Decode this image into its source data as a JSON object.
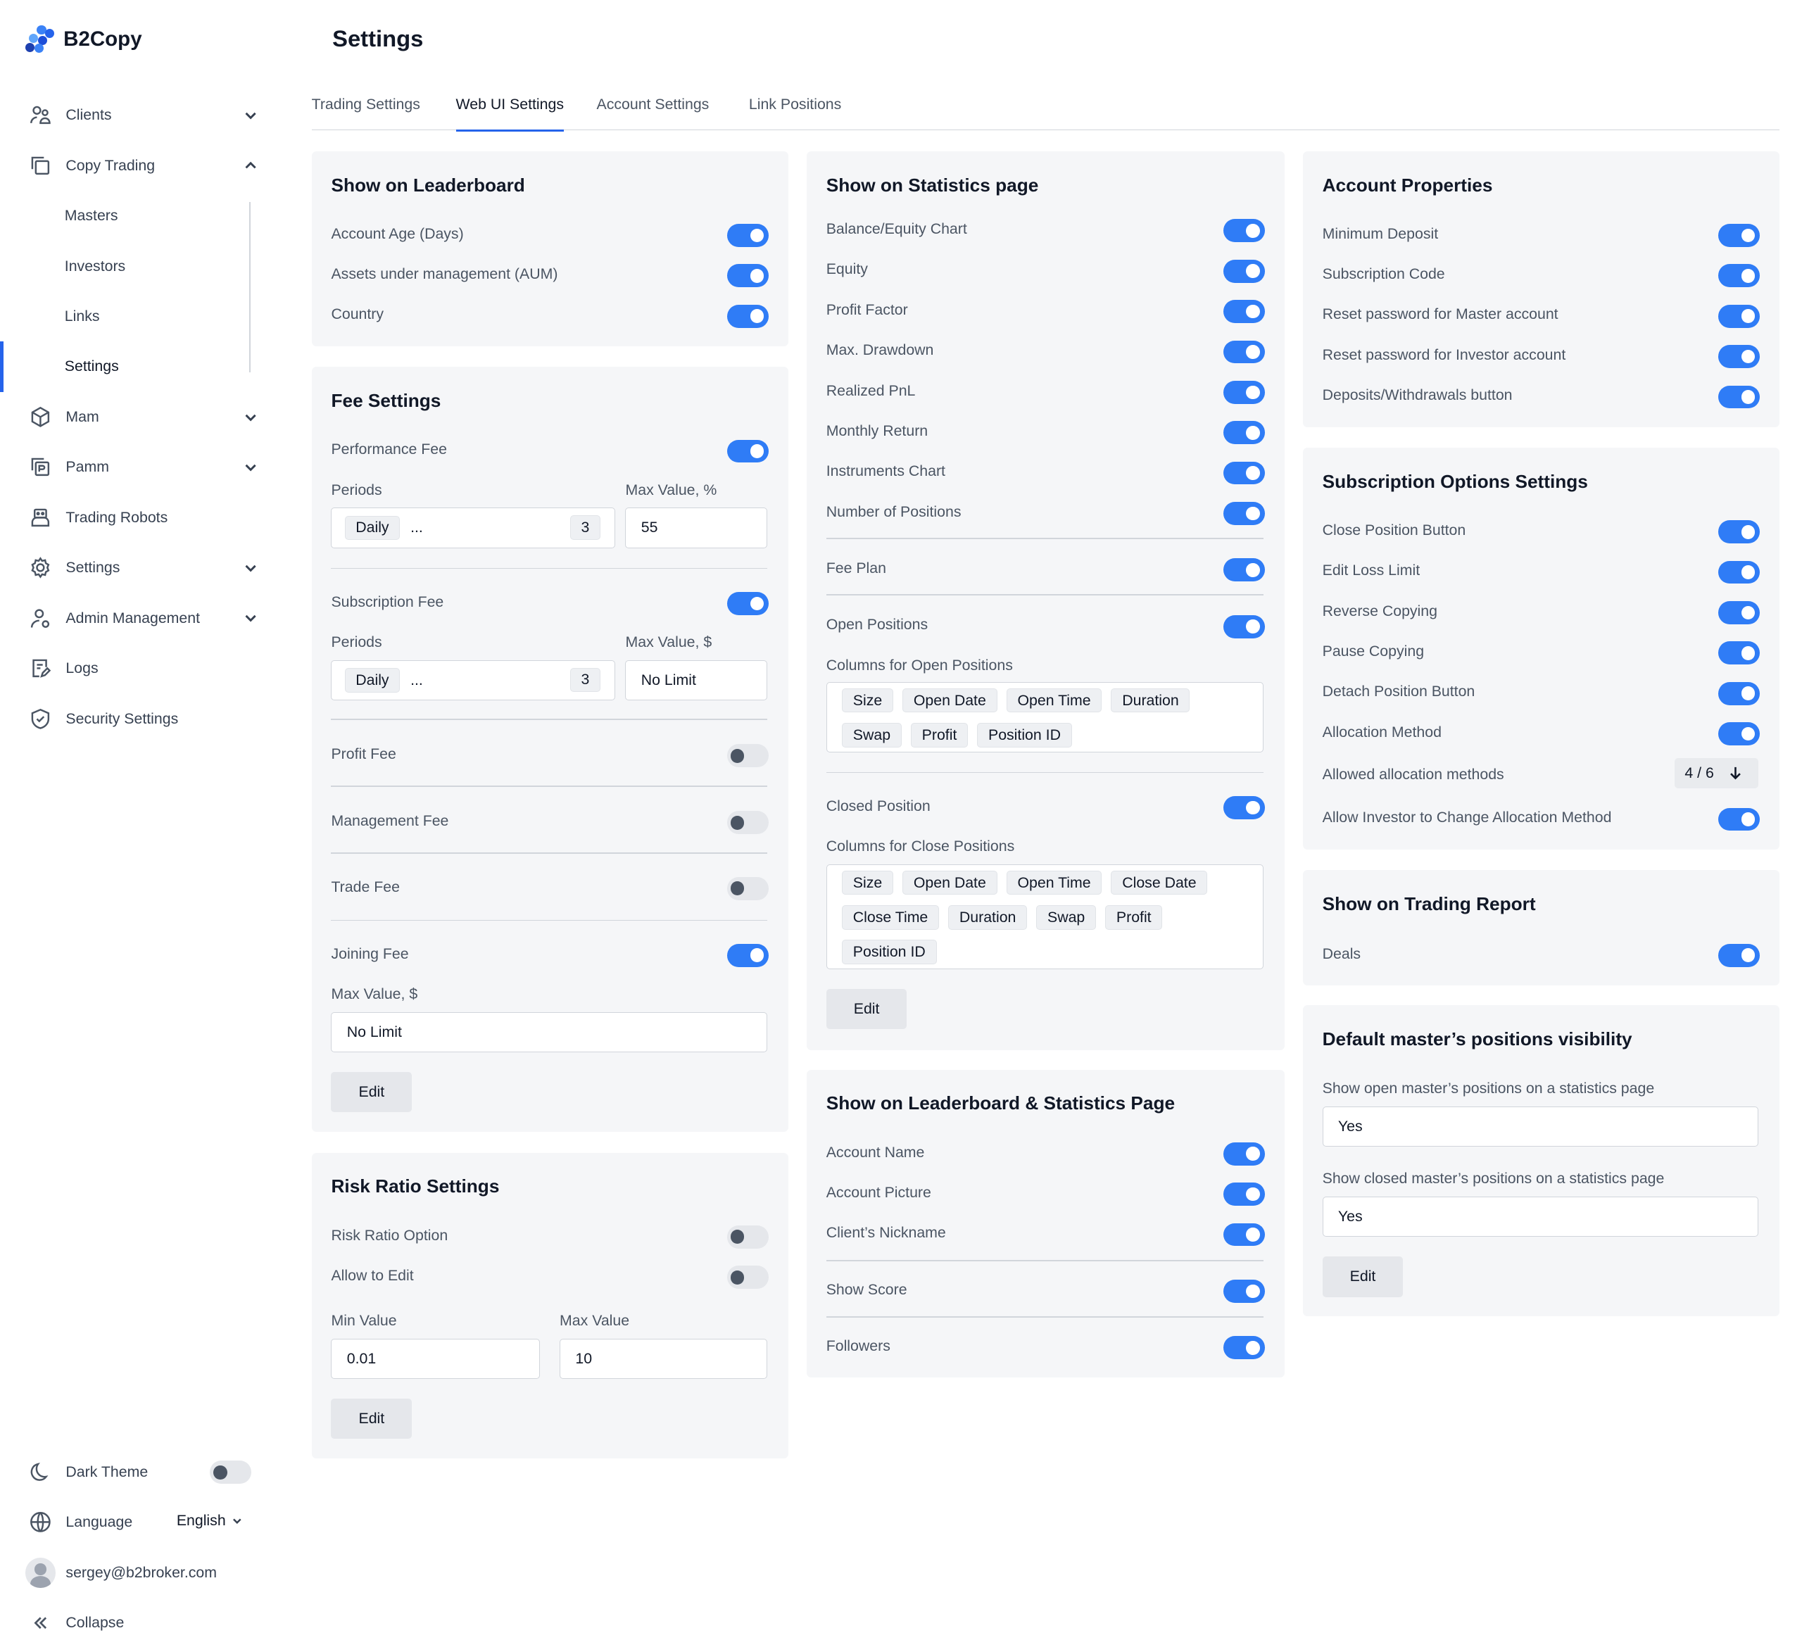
{
  "brand": {
    "name": "B2Copy"
  },
  "sidebar": {
    "items": [
      {
        "label": "Clients",
        "icon": "users-icon",
        "chevron": "down"
      },
      {
        "label": "Copy Trading",
        "icon": "copy-icon",
        "chevron": "up"
      },
      {
        "label": "Masters",
        "sub": true
      },
      {
        "label": "Investors",
        "sub": true
      },
      {
        "label": "Links",
        "sub": true
      },
      {
        "label": "Settings",
        "sub": true,
        "active": true
      },
      {
        "label": "Mam",
        "icon": "cube-icon",
        "chevron": "down"
      },
      {
        "label": "Pamm",
        "icon": "pamm-icon",
        "chevron": "down"
      },
      {
        "label": "Trading Robots",
        "icon": "robot-icon"
      },
      {
        "label": "Settings",
        "icon": "gear-icon",
        "chevron": "down"
      },
      {
        "label": "Admin Management",
        "icon": "admin-icon",
        "chevron": "down"
      },
      {
        "label": "Logs",
        "icon": "logs-icon"
      },
      {
        "label": "Security Settings",
        "icon": "shield-icon"
      }
    ],
    "dark_theme": "Dark Theme",
    "language_label": "Language",
    "language_value": "English",
    "user_email": "sergey@b2broker.com",
    "collapse": "Collapse"
  },
  "page": {
    "title": "Settings"
  },
  "tabs": [
    {
      "label": "Trading Settings",
      "active": false
    },
    {
      "label": "Web UI Settings",
      "active": true
    },
    {
      "label": "Account Settings",
      "active": false
    },
    {
      "label": "Link Positions",
      "active": false
    }
  ],
  "leaderboard": {
    "title": "Show on Leaderboard",
    "rows": [
      {
        "label": "Account Age (Days)",
        "on": true
      },
      {
        "label": "Assets under management (AUM)",
        "on": true
      },
      {
        "label": "Country",
        "on": true
      }
    ]
  },
  "fee": {
    "title": "Fee Settings",
    "performance": {
      "label": "Performance Fee",
      "on": true,
      "periods_label": "Periods",
      "period_chip": "Daily",
      "dots": "...",
      "count": "3",
      "max_label": "Max Value, %",
      "max_value": "55"
    },
    "subscription": {
      "label": "Subscription Fee",
      "on": true,
      "periods_label": "Periods",
      "period_chip": "Daily",
      "dots": "...",
      "count": "3",
      "max_label": "Max Value, $",
      "max_value": "No Limit"
    },
    "profit": {
      "label": "Profit Fee",
      "on": false
    },
    "management": {
      "label": "Management Fee",
      "on": false
    },
    "trade": {
      "label": "Trade Fee",
      "on": false
    },
    "joining": {
      "label": "Joining Fee",
      "on": true,
      "max_label": "Max Value, $",
      "max_value": "No Limit"
    },
    "edit": "Edit"
  },
  "risk": {
    "title": "Risk Ratio Settings",
    "option": {
      "label": "Risk Ratio Option",
      "on": false
    },
    "allow": {
      "label": "Allow to Edit",
      "on": false
    },
    "min_label": "Min Value",
    "min_value": "0.01",
    "max_label": "Max Value",
    "max_value": "10",
    "edit": "Edit"
  },
  "stats": {
    "title": "Show on Statistics page",
    "rows": [
      {
        "label": "Balance/Equity Chart",
        "on": true
      },
      {
        "label": "Equity",
        "on": true
      },
      {
        "label": "Profit Factor",
        "on": true
      },
      {
        "label": "Max. Drawdown",
        "on": true
      },
      {
        "label": "Realized PnL",
        "on": true
      },
      {
        "label": "Monthly Return",
        "on": true
      },
      {
        "label": "Instruments Chart",
        "on": true
      },
      {
        "label": "Number of Positions",
        "on": true
      }
    ],
    "fee_plan": {
      "label": "Fee Plan",
      "on": true
    },
    "open_positions": {
      "label": "Open Positions",
      "on": true,
      "columns_label": "Columns for Open Positions",
      "columns": [
        "Size",
        "Open Date",
        "Open Time",
        "Duration",
        "Swap",
        "Profit",
        "Position ID"
      ]
    },
    "closed_position": {
      "label": "Closed Position",
      "on": true,
      "columns_label": "Columns for Close Positions",
      "columns": [
        "Size",
        "Open Date",
        "Open Time",
        "Close Date",
        "Close Time",
        "Duration",
        "Swap",
        "Profit",
        "Position ID"
      ]
    },
    "edit": "Edit"
  },
  "lb_stats": {
    "title": "Show on Leaderboard & Statistics Page",
    "rows": [
      {
        "label": "Account Name",
        "on": true
      },
      {
        "label": "Account Picture",
        "on": true
      },
      {
        "label": "Client’s Nickname",
        "on": true
      }
    ],
    "score": {
      "label": "Show Score",
      "on": true
    },
    "followers": {
      "label": "Followers",
      "on": true
    }
  },
  "account_props": {
    "title": "Account Properties",
    "rows": [
      {
        "label": "Minimum Deposit",
        "on": true
      },
      {
        "label": "Subscription Code",
        "on": true
      },
      {
        "label": "Reset password for Master account",
        "on": true
      },
      {
        "label": "Reset password for Investor account",
        "on": true
      },
      {
        "label": "Deposits/Withdrawals button",
        "on": true
      }
    ]
  },
  "subscription_opts": {
    "title": "Subscription Options Settings",
    "rows": [
      {
        "label": "Close Position Button",
        "on": true
      },
      {
        "label": "Edit Loss Limit",
        "on": true
      },
      {
        "label": "Reverse Copying",
        "on": true
      },
      {
        "label": "Pause Copying",
        "on": true
      },
      {
        "label": "Detach Position Button",
        "on": true
      },
      {
        "label": "Allocation Method",
        "on": true
      }
    ],
    "allowed_label": "Allowed allocation methods",
    "allowed_value": "4 / 6",
    "allow_change": {
      "label": "Allow Investor to Change Allocation Method",
      "on": true
    }
  },
  "trading_report": {
    "title": "Show on Trading Report",
    "deals": {
      "label": "Deals",
      "on": true
    }
  },
  "visibility": {
    "title": "Default master’s positions visibility",
    "open_label": "Show open master’s positions on a statistics page",
    "open_value": "Yes",
    "closed_label": "Show closed master’s positions on a statistics page",
    "closed_value": "Yes",
    "edit": "Edit"
  },
  "colors": {
    "accent": "#2f7cf6",
    "card_bg": "#f5f6f8",
    "toggle_off": "#e5e7eb"
  }
}
